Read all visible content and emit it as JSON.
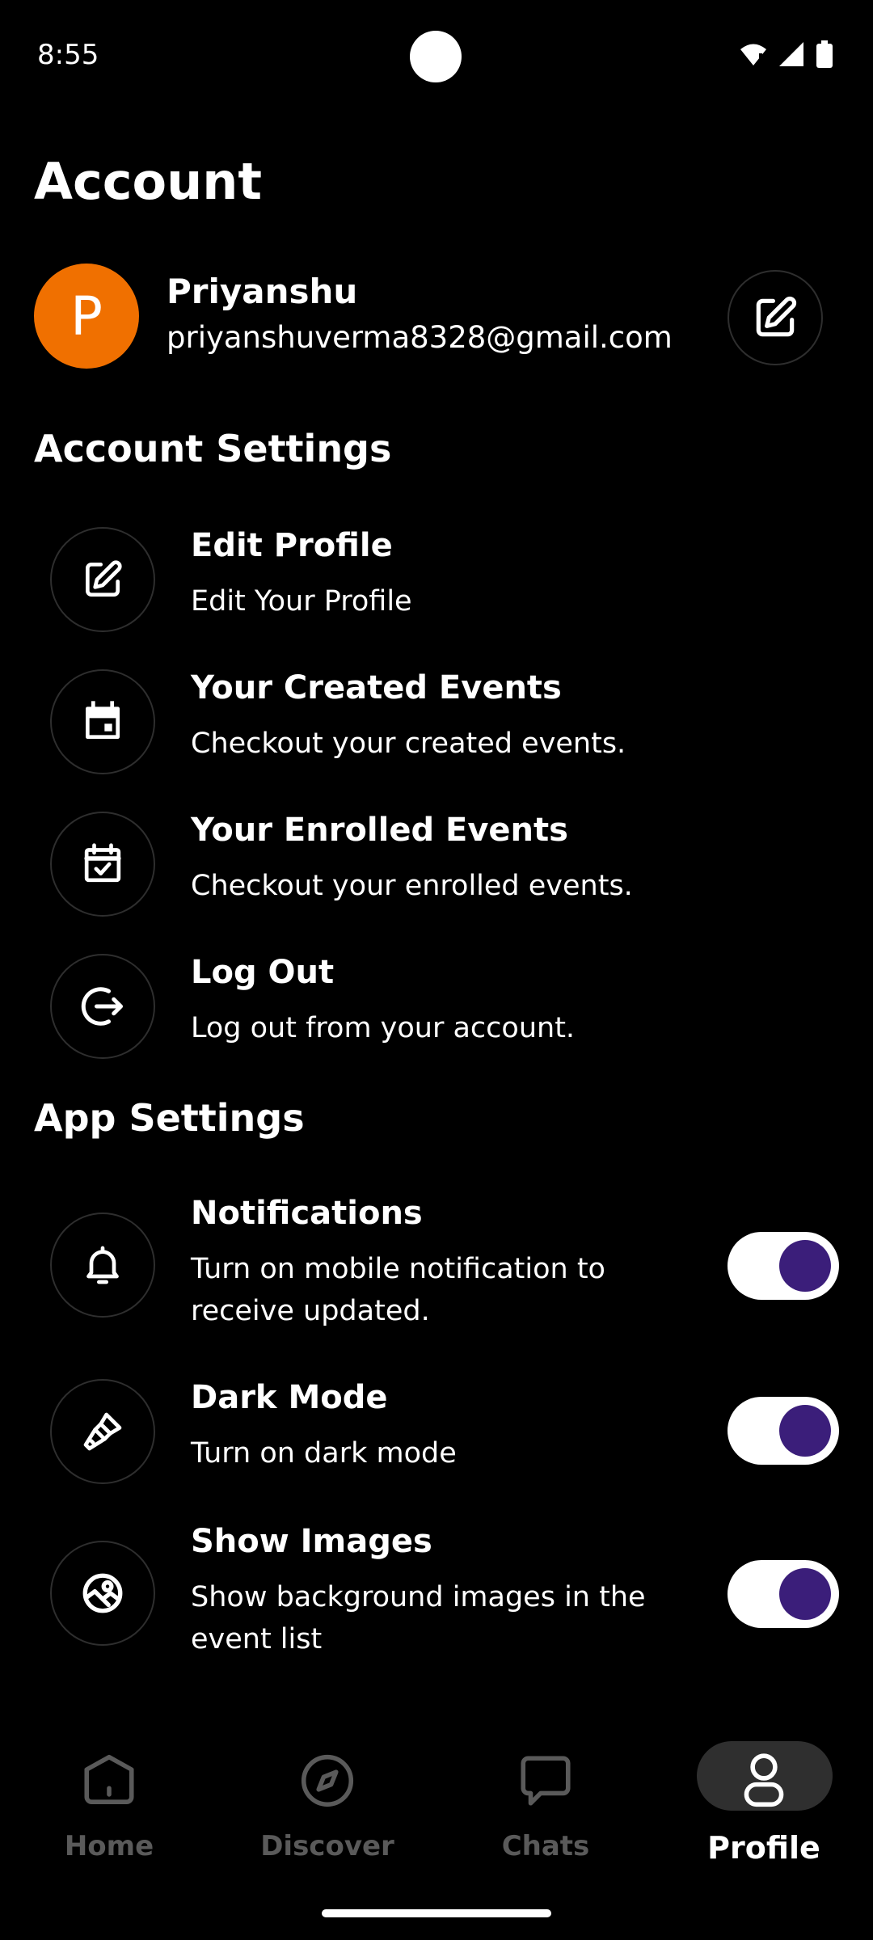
{
  "status_bar": {
    "time": "8:55"
  },
  "page": {
    "title": "Account"
  },
  "profile": {
    "initial": "P",
    "name": "Priyanshu",
    "email": "priyanshuverma8328@gmail.com",
    "avatar_color": "#f07000"
  },
  "account_settings": {
    "title": "Account Settings",
    "items": [
      {
        "icon": "edit-icon",
        "title": "Edit Profile",
        "subtitle": "Edit Your Profile"
      },
      {
        "icon": "calendar-icon",
        "title": "Your Created Events",
        "subtitle": "Checkout your created events."
      },
      {
        "icon": "calendar-check-icon",
        "title": "Your Enrolled Events",
        "subtitle": "Checkout your enrolled events."
      },
      {
        "icon": "logout-icon",
        "title": "Log Out",
        "subtitle": "Log out from your account."
      }
    ]
  },
  "app_settings": {
    "title": "App Settings",
    "items": [
      {
        "icon": "bell-icon",
        "title": "Notifications",
        "subtitle": "Turn on mobile notification to receive updated.",
        "enabled": true
      },
      {
        "icon": "paint-brush-icon",
        "title": "Dark Mode",
        "subtitle": "Turn on dark mode",
        "enabled": true
      },
      {
        "icon": "image-icon",
        "title": "Show Images",
        "subtitle": "Show background images in the event list",
        "enabled": true
      }
    ]
  },
  "bottom_nav": {
    "items": [
      {
        "icon": "home-icon",
        "label": "Home",
        "active": false
      },
      {
        "icon": "compass-icon",
        "label": "Discover",
        "active": false
      },
      {
        "icon": "chat-icon",
        "label": "Chats",
        "active": false
      },
      {
        "icon": "profile-icon",
        "label": "Profile",
        "active": true
      }
    ]
  },
  "colors": {
    "toggle_knob": "#3b1e7a",
    "toggle_track": "#ffffff",
    "active_pill": "#2f2f2f"
  }
}
